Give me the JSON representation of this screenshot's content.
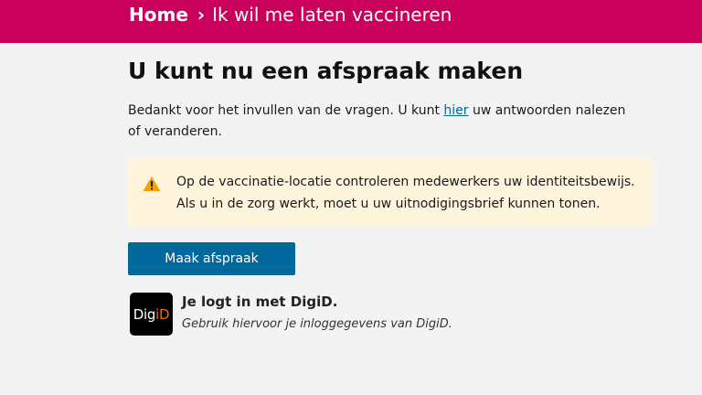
{
  "header": {
    "breadcrumb_home": "Home",
    "breadcrumb_separator": "›",
    "breadcrumb_current": "Ik wil me laten vaccineren",
    "background_color": "#ca005d"
  },
  "main": {
    "title": "U kunt nu een afspraak maken",
    "intro_before_link": "Bedankt voor het invullen van de vragen. U kunt ",
    "intro_link": "hier",
    "intro_after_link": " uw antwoorden nalezen of veranderen.",
    "notice": {
      "icon": "warning-icon",
      "line1": "Op de vaccinatie-locatie controleren medewerkers uw identiteitsbewijs.",
      "line2": "Als u in de zorg werkt, moet u uw uitnodigingsbrief kunnen tonen.",
      "background_color": "#fff4dc"
    },
    "primary_button": "Maak afspraak",
    "digid": {
      "logo_prefix": "Dig",
      "logo_accent": "iD",
      "title": "Je logt in met DigiD.",
      "subtitle": "Gebruik hiervoor je inloggegevens van DigiD."
    }
  },
  "colors": {
    "link": "#01689b",
    "button": "#01689b",
    "page_background": "#f3f3f3",
    "digid_accent": "#e17000"
  }
}
